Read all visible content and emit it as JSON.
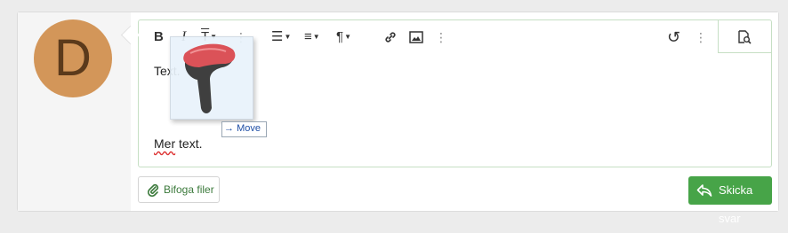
{
  "avatar": {
    "letter": "D"
  },
  "toolbar": {
    "bold": "B",
    "italic": "I",
    "text_size": "T",
    "more": "⋮",
    "list": "☰",
    "align": "≡",
    "paragraph": "¶",
    "link": "🔗",
    "image": "▣",
    "more2": "⋮",
    "undo": "↺",
    "more3": "⋮"
  },
  "editor": {
    "line1": "Text.",
    "line2": "Mer text."
  },
  "drag": {
    "tooltip": "Move",
    "tooltip_arrow": "→"
  },
  "buttons": {
    "attach": "Bifoga filer",
    "send": "Skicka svar"
  },
  "colors": {
    "accent": "#47a448",
    "avatar": "#d39659",
    "border": "#c6dfc4"
  }
}
